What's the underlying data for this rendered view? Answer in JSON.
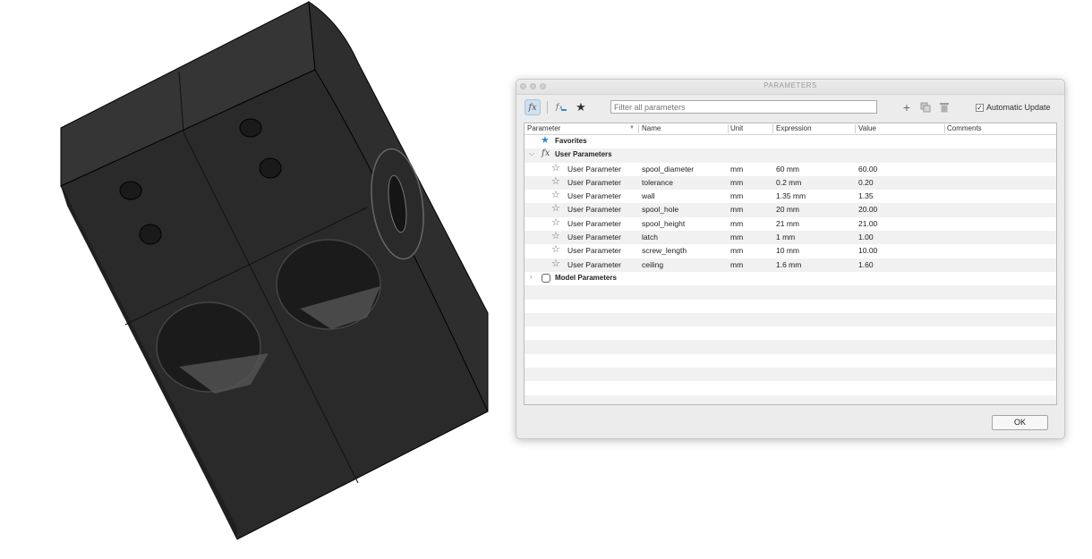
{
  "dialog": {
    "title": "PARAMETERS",
    "filter_placeholder": "Filter all parameters",
    "auto_update_label": "Automatic Update",
    "auto_update_checked": true,
    "ok_label": "OK"
  },
  "toolbar": {
    "icons": [
      "fx-icon",
      "fx-change-icon",
      "favorite-star-icon",
      "add-icon",
      "copy-icon",
      "delete-icon"
    ],
    "fx_text": "fx",
    "add_glyph": "+",
    "star_glyph": "★"
  },
  "columns": [
    "Parameter",
    "Name",
    "Unit",
    "Expression",
    "Value",
    "Comments"
  ],
  "groups": {
    "favorites": "Favorites",
    "user": "User Parameters",
    "model": "Model Parameters"
  },
  "rows": [
    {
      "type": "User Parameter",
      "name": "spool_diameter",
      "unit": "mm",
      "expression": "60 mm",
      "value": "60.00"
    },
    {
      "type": "User Parameter",
      "name": "tolerance",
      "unit": "mm",
      "expression": "0.2 mm",
      "value": "0.20"
    },
    {
      "type": "User Parameter",
      "name": "wall",
      "unit": "mm",
      "expression": "1.35 mm",
      "value": "1.35"
    },
    {
      "type": "User Parameter",
      "name": "spool_hole",
      "unit": "mm",
      "expression": "20 mm",
      "value": "20.00"
    },
    {
      "type": "User Parameter",
      "name": "spool_height",
      "unit": "mm",
      "expression": "21 mm",
      "value": "21.00"
    },
    {
      "type": "User Parameter",
      "name": "latch",
      "unit": "mm",
      "expression": "1 mm",
      "value": "1.00"
    },
    {
      "type": "User Parameter",
      "name": "screw_length",
      "unit": "mm",
      "expression": "10 mm",
      "value": "10.00"
    },
    {
      "type": "User Parameter",
      "name": "ceiling",
      "unit": "mm",
      "expression": "1.6 mm",
      "value": "1.60"
    }
  ],
  "colors": {
    "favorite_star": "#2a8fd4",
    "model_body": "#2b2b2b",
    "model_edge": "#000000"
  }
}
